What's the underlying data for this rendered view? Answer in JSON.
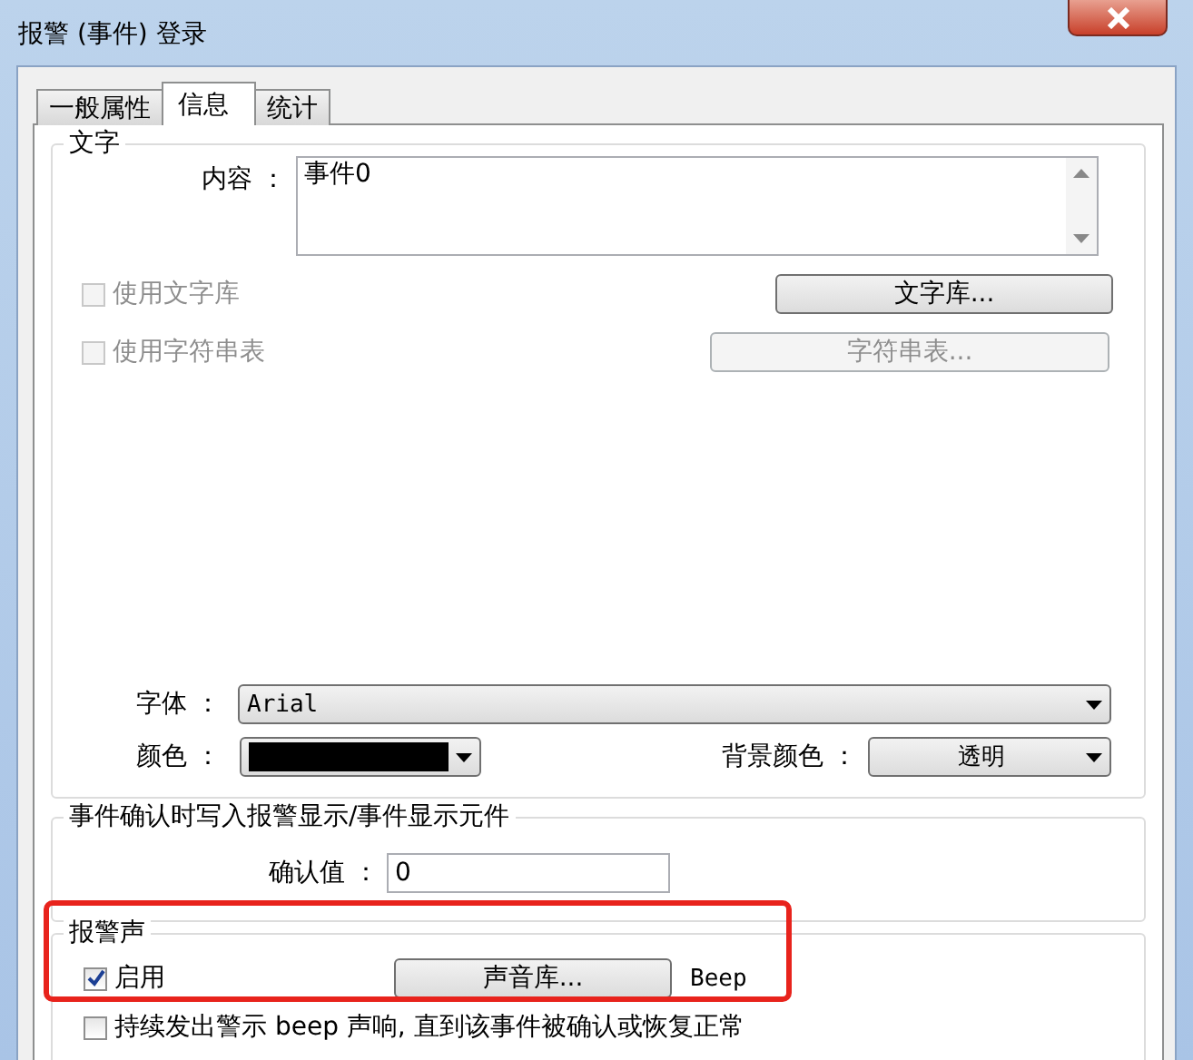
{
  "window": {
    "title": "报警 (事件) 登录"
  },
  "tabs": [
    {
      "label": "一般属性",
      "selected": false
    },
    {
      "label": "信息",
      "selected": true
    },
    {
      "label": "统计",
      "selected": false
    }
  ],
  "text_group": {
    "title": "文字",
    "content_label": "内容 ：",
    "content_value": "事件0",
    "use_text_library": {
      "label": "使用文字库",
      "checked": false,
      "disabled": true
    },
    "text_library_button": {
      "label": "文字库...",
      "disabled": false
    },
    "use_string_table": {
      "label": "使用字符串表",
      "checked": false,
      "disabled": true
    },
    "string_table_button": {
      "label": "字符串表...",
      "disabled": true
    },
    "font_label": "字体 ：",
    "font_value": "Arial",
    "color_label": "颜色 ：",
    "color_swatch": {
      "color": "#000000"
    },
    "bg_color_label": "背景颜色 ：",
    "bg_color_value": "透明"
  },
  "confirm_group": {
    "title": "事件确认时写入报警显示/事件显示元件",
    "confirm_label": "确认值 ：",
    "confirm_value": "0"
  },
  "sound_group": {
    "title": "报警声",
    "enable": {
      "label": "启用",
      "checked": true,
      "disabled": false
    },
    "sound_library_button": "声音库...",
    "sound_name": "Beep",
    "continuous": {
      "label": "持续发出警示 beep 声响, 直到该事件被确认或恢复正常",
      "checked": false,
      "disabled": false
    }
  }
}
